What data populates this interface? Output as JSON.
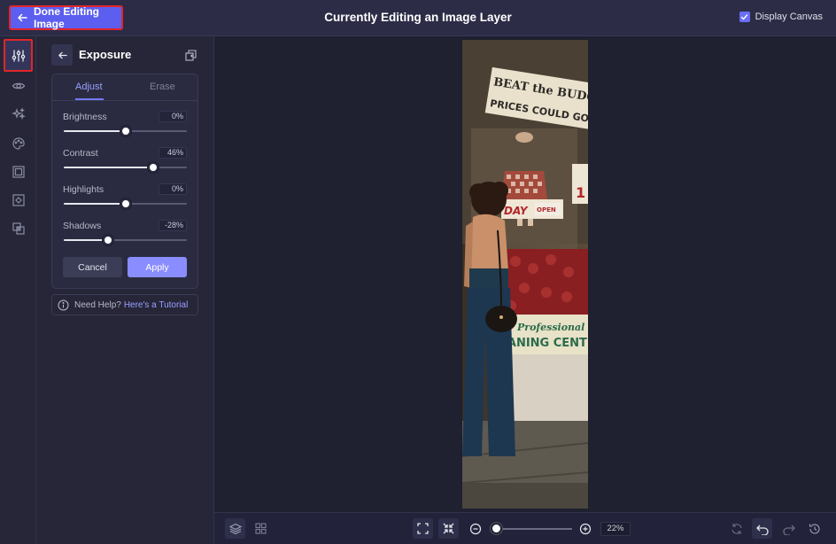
{
  "topbar": {
    "done_label": "Done Editing Image",
    "title": "Currently Editing an Image Layer",
    "display_canvas_label": "Display Canvas",
    "display_canvas_checked": true
  },
  "rail": {
    "items": [
      {
        "name": "adjust-sliders-icon",
        "active": true
      },
      {
        "name": "eye-icon",
        "active": false
      },
      {
        "name": "sparkle-effects-icon",
        "active": false
      },
      {
        "name": "palette-icon",
        "active": false
      },
      {
        "name": "frame-icon",
        "active": false
      },
      {
        "name": "mask-icon",
        "active": false
      },
      {
        "name": "layers-overlap-icon",
        "active": false
      }
    ]
  },
  "panel": {
    "title": "Exposure",
    "tabs": [
      {
        "label": "Adjust",
        "active": true
      },
      {
        "label": "Erase",
        "active": false
      }
    ],
    "sliders": [
      {
        "label": "Brightness",
        "value": "0%",
        "percent": 0
      },
      {
        "label": "Contrast",
        "value": "46%",
        "percent": 46
      },
      {
        "label": "Highlights",
        "value": "0%",
        "percent": 0
      },
      {
        "label": "Shadows",
        "value": "-28%",
        "percent": -28
      }
    ],
    "cancel_label": "Cancel",
    "apply_label": "Apply",
    "help_text": "Need Help?",
    "help_link": "Here's a Tutorial"
  },
  "canvas": {
    "image_signs": {
      "sign1": "BEAT the BUDGET & BUY",
      "sign2": "PRICES COULD GO U",
      "day": "DAY",
      "open": "OPEN",
      "professional": "Professional",
      "cleaning": "EANING CENT",
      "price": "1"
    }
  },
  "bottombar": {
    "zoom": "22%",
    "zoom_percent": 22
  },
  "colors": {
    "accent": "#5c5ef0",
    "apply": "#8a8dff",
    "highlight_border": "#e0262b",
    "background": "#1f2030"
  }
}
